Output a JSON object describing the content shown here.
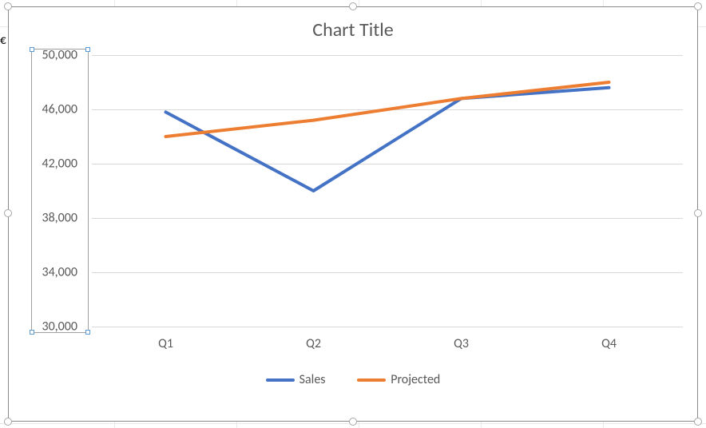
{
  "chart_data": {
    "type": "line",
    "title": "Chart Title",
    "categories": [
      "Q1",
      "Q2",
      "Q3",
      "Q4"
    ],
    "series": [
      {
        "name": "Sales",
        "color": "#4472c4",
        "values": [
          45800,
          40000,
          46800,
          47600
        ]
      },
      {
        "name": "Projected",
        "color": "#ed7d31",
        "values": [
          44000,
          45200,
          46800,
          48000
        ]
      }
    ],
    "xlabel": "",
    "ylabel": "",
    "ylim": [
      30000,
      50000
    ],
    "y_tick_labels": [
      "30,000",
      "34,000",
      "38,000",
      "42,000",
      "46,000",
      "50,000"
    ],
    "y_ticks": [
      30000,
      34000,
      38000,
      42000,
      46000,
      50000
    ]
  },
  "selection": {
    "axis": "y"
  }
}
